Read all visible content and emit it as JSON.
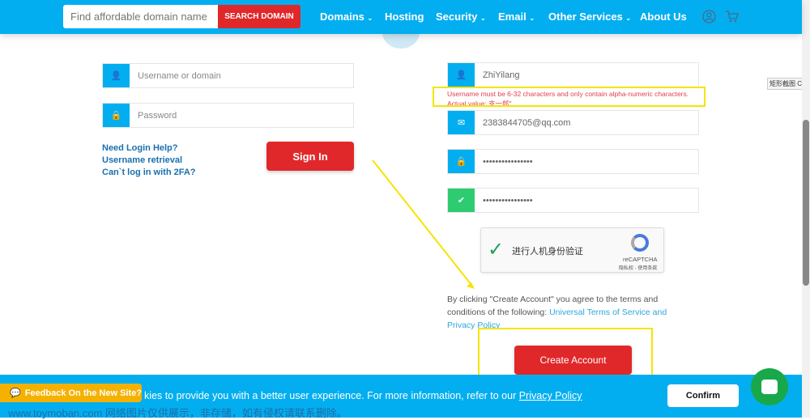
{
  "nav": {
    "search_placeholder": "Find affordable domain name",
    "search_button": "SEARCH DOMAIN",
    "items": [
      {
        "label": "Domains",
        "dropdown": true
      },
      {
        "label": "Hosting"
      },
      {
        "label": "Security",
        "dropdown": true
      },
      {
        "label": "Email",
        "dropdown": true
      },
      {
        "label": "Other Services",
        "dropdown": true
      },
      {
        "label": "About Us"
      }
    ]
  },
  "login": {
    "username_placeholder": "Username or domain",
    "password_placeholder": "Password",
    "links": [
      "Need Login Help?",
      "Username retrieval",
      "Can`t log in with 2FA?"
    ],
    "sign_in": "Sign In"
  },
  "register": {
    "username_value": "ZhiYilang",
    "error_line1": "Username must be 6-32 characters and only contain alpha-numeric characters.",
    "error_line2": "Actual value: 支一郎\"",
    "email_value": "2383844705@qq.com",
    "password_value": "••••••••••••••••",
    "confirm_value": "••••••••••••••••",
    "captcha_label": "进行人机身份验证",
    "captcha_brand": "reCAPTCHA",
    "captcha_links": "隐私权 - 使用条款",
    "terms_text": "By clicking \"Create Account\" you agree to the terms and conditions of the following: ",
    "terms_link": "Universal Terms of Service and Privacy Policy",
    "create_button": "Create Account"
  },
  "cookie": {
    "text": "kies to provide you with a better user experience. For more information, refer to our ",
    "link": "Privacy Policy",
    "confirm": "Confirm"
  },
  "feedback": "Feedback On the New Site?",
  "watermark": "www.toymoban.com 网络图片仅供展示，非存储，如有侵权请联系删除。",
  "tooltip": "矩形截图 Ctrl +",
  "colors": {
    "brand": "#02aef0",
    "accent": "#e0282a",
    "success": "#2ecc71",
    "highlight": "#f5e400",
    "feedback": "#f5b100"
  }
}
